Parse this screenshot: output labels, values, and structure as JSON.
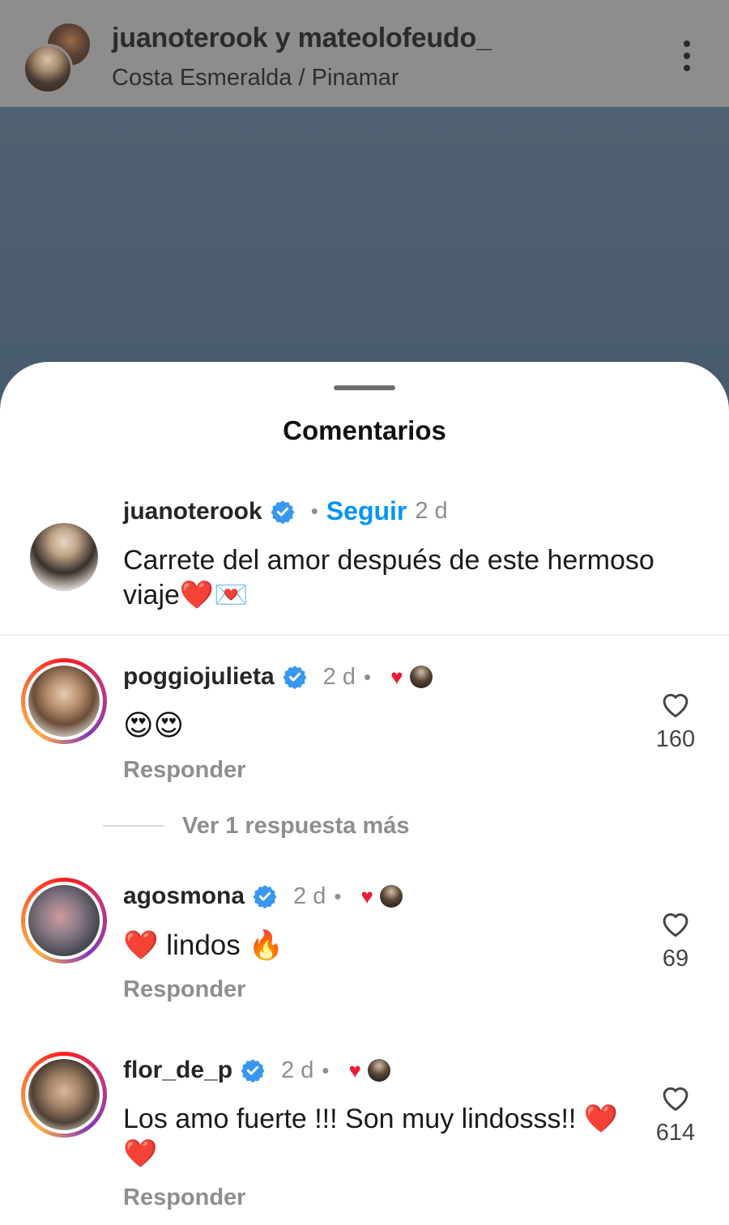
{
  "header": {
    "title": "juanoterook y mateolofeudo_",
    "location": "Costa Esmeralda / Pinamar"
  },
  "sheet": {
    "title": "Comentarios"
  },
  "caption": {
    "username": "juanoterook",
    "follow_label": "Seguir",
    "separator": "•",
    "time": "2 d",
    "text": "Carrete del amor después de este hermoso viaje❤️💌"
  },
  "comments": [
    {
      "username": "poggiojulieta",
      "time": "2 d",
      "separator": "•",
      "text": "😍😍",
      "reply_label": "Responder",
      "likes": "160"
    },
    {
      "username": "agosmona",
      "time": "2 d",
      "separator": "•",
      "text": "❤️ lindos 🔥",
      "reply_label": "Responder",
      "likes": "69"
    },
    {
      "username": "flor_de_p",
      "time": "2 d",
      "separator": "•",
      "text": "Los amo fuerte !!! Son muy lindosss!! ❤️❤️",
      "reply_label": "Responder",
      "likes": "614"
    }
  ],
  "more_replies": "Ver 1 respuesta más",
  "icons": [
    "verified-badge-icon",
    "heart-outline-icon",
    "liked-heart-icon",
    "more-options-icon"
  ],
  "colors": {
    "link_blue": "#0095f6",
    "verified_blue": "#3897f0",
    "heart_red": "#ed1c35",
    "muted_gray": "#8e8e8e"
  }
}
